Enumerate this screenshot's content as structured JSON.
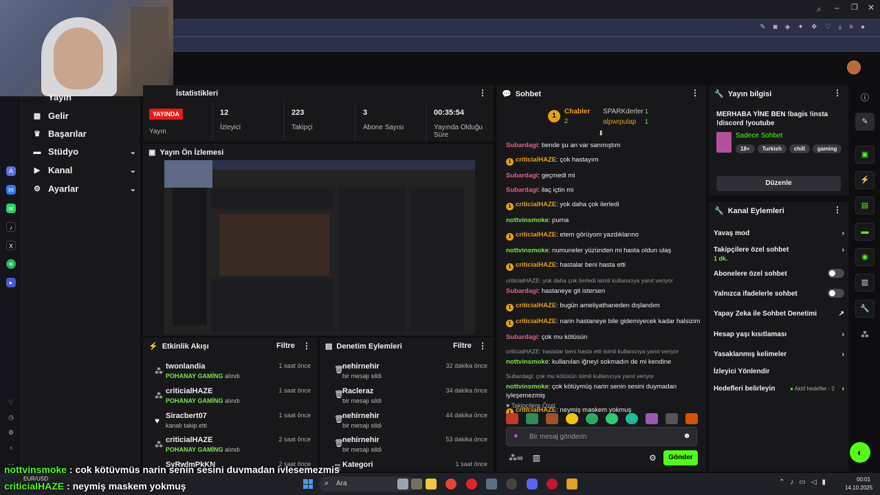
{
  "stats": {
    "title": "İstatistikleri",
    "live_badge": "YAYINDA",
    "live_label": "Yayın",
    "viewers_value": "12",
    "viewers_label": "İzleyici",
    "followers_value": "223",
    "followers_label": "Takipçi",
    "subs_value": "3",
    "subs_label": "Abone Sayısı",
    "uptime_value": "00:35:54",
    "uptime_label": "Yayında Olduğu Süre"
  },
  "nav": {
    "partial_top": "Yayın",
    "items": [
      {
        "label": "Gelir",
        "icon": "dollar-icon"
      },
      {
        "label": "Başarılar",
        "icon": "trophy-icon"
      },
      {
        "label": "Stüdyo",
        "icon": "studio-icon"
      },
      {
        "label": "Kanal",
        "icon": "channel-icon"
      },
      {
        "label": "Ayarlar",
        "icon": "gear-icon"
      }
    ]
  },
  "preview": {
    "title": "Yayın Ön İzlemesi"
  },
  "activity": {
    "title": "Etkinlik Akışı",
    "filter": "Filtre",
    "items": [
      {
        "name": "twonlandia",
        "game": "POHANAY GAMİNG",
        "suffix": " alındı",
        "time": "1 saat önce"
      },
      {
        "name": "criticialHAZE",
        "game": "POHANAY GAMİNG",
        "suffix": " alındı",
        "time": "1 saat önce"
      },
      {
        "name": "Siracbert07",
        "game": "",
        "suffix": "kanalı takip etti",
        "time": "1 saat önce"
      },
      {
        "name": "criticialHAZE",
        "game": "POHANAY GAMİNG",
        "suffix": " alındı",
        "time": "2 saat önce"
      },
      {
        "name": "SyRwlmPkKN",
        "game": "",
        "suffix": "",
        "time": "2 saat önce"
      }
    ]
  },
  "moderation": {
    "title": "Denetim Eylemleri",
    "filter": "Filtre",
    "items": [
      {
        "name": "nehirnehir",
        "desc": "bir mesajı sildi",
        "time": "32 dakika önce"
      },
      {
        "name": "Racleraz",
        "desc": "bir mesajı sildi",
        "time": "34 dakika önce"
      },
      {
        "name": "nehirnehir",
        "desc": "bir mesajı sildi",
        "time": "44 dakika önce"
      },
      {
        "name": "nehirnehir",
        "desc": "bir mesajı sildi",
        "time": "53 dakika önce"
      },
      {
        "name": "Kategori",
        "desc": "",
        "time": "1 saat önce"
      }
    ]
  },
  "chat": {
    "title": "Sohbet",
    "leader1": "Chabler",
    "leader1_count": "2",
    "leader2": "SPARKderler",
    "leader2_count": "1",
    "leader3": "alpwrpulap",
    "leader3_count": "1",
    "messages": [
      {
        "reply": "",
        "badge": false,
        "user": "Subardagi",
        "color": "#e95d86",
        "text": "bende şu an var sanmıştım"
      },
      {
        "reply": "",
        "badge": true,
        "user": "criticialHAZE",
        "color": "#e5a019",
        "text": "çok hastayım"
      },
      {
        "reply": "",
        "badge": false,
        "user": "Subardagi",
        "color": "#e95d86",
        "text": "geçmedi mi"
      },
      {
        "reply": "",
        "badge": false,
        "user": "Subardagi",
        "color": "#e95d86",
        "text": "ilaç içtin mi"
      },
      {
        "reply": "",
        "badge": true,
        "user": "criticialHAZE",
        "color": "#e5a019",
        "text": "yok daha çok ilerledi"
      },
      {
        "reply": "",
        "badge": false,
        "user": "nottvinsmoke",
        "color": "#7fe34d",
        "text": "purna"
      },
      {
        "reply": "",
        "badge": true,
        "user": "criticialHAZE",
        "color": "#e5a019",
        "text": "etem görüyom yazdıklarıno"
      },
      {
        "reply": "",
        "badge": false,
        "user": "nottvinsmoke",
        "color": "#7fe34d",
        "text": "numuneler yüzünden mi hasta oldun ulaş"
      },
      {
        "reply": "",
        "badge": true,
        "user": "criticialHAZE",
        "color": "#e5a019",
        "text": "hastalar beni hasta etti"
      },
      {
        "reply": "criticialHAZE: yok daha çok ilerledi isimli kullanıcıya yanıt veriyor",
        "badge": false,
        "user": "Subardagi",
        "color": "#e95d86",
        "text": "hastaneye git istersen"
      },
      {
        "reply": "",
        "badge": true,
        "user": "criticialHAZE",
        "color": "#e5a019",
        "text": "bugün ameliyathaneden dışlandım"
      },
      {
        "reply": "",
        "badge": true,
        "user": "criticialHAZE",
        "color": "#e5a019",
        "text": "narin hastaneye bile gidemiyecek kadar halsizim"
      },
      {
        "reply": "",
        "badge": false,
        "user": "Subardagi",
        "color": "#e95d86",
        "text": "çok mu kötüsün"
      },
      {
        "reply": "criticialHAZE: hastalar beni hasta etti isimli kullanıcıya yanıt veriyor",
        "badge": false,
        "user": "nottvinsmoke",
        "color": "#7fe34d",
        "text": "kullanılan iğneyi sokmadın de mi kendine"
      },
      {
        "reply": "Subardagi: çok mu kötüsün isimli kullanıcıya yanıt veriyor",
        "badge": false,
        "user": "nottvinsmoke",
        "color": "#7fe34d",
        "text": "çok kötüymüş narin senin sesini duymadan iyleşemezmiş"
      },
      {
        "reply": "",
        "badge": true,
        "user": "criticialHAZE",
        "color": "#e5a019",
        "text": "neymiş maskem yokmuş"
      }
    ],
    "followers_emotes": "Takipçilere Özel",
    "input_placeholder": "Bir mesaj gönderin",
    "send": "Gönder"
  },
  "stream_info": {
    "title": "Yayın bilgisi",
    "description": "MERHABA YİNE BEN !bagis !insta !discord !youtube",
    "category": "Sadece Sohbet",
    "tags": [
      "18+",
      "Turkish",
      "chill",
      "gaming"
    ],
    "edit": "Düzenle"
  },
  "channel_actions": {
    "title": "Kanal Eylemleri",
    "slow_mode": "Yavaş mod",
    "followers_only": "Takipçilere özel sohbet",
    "followers_only_value": "1 dk.",
    "subs_only": "Abonelere özel sohbet",
    "emotes_only": "Yalnızca ifadelerle sohbet",
    "ai_mod": "Yapay Zeka ile Sohbet Denetimi",
    "age": "Hesap yaşı kısıtlaması",
    "banned_words": "Yasaklanmış kelimeler",
    "redirect": "İzleyici Yönlendir",
    "goals": "Hedefleri belirleyin",
    "goals_status": "Aktif hedefler - 2"
  },
  "taskbar": {
    "search": "Ara",
    "currency": "EUR/USD",
    "time": "00:01",
    "date": "14.10.2025"
  },
  "overlay": {
    "line1_user": "nottvinsmoke",
    "line1_text": " : çok kötüymüş narin senin sesini duymadan iyleşemezmiş",
    "line2_user": "criticialHAZE",
    "line2_text": " : neymiş maskem yokmuş"
  }
}
